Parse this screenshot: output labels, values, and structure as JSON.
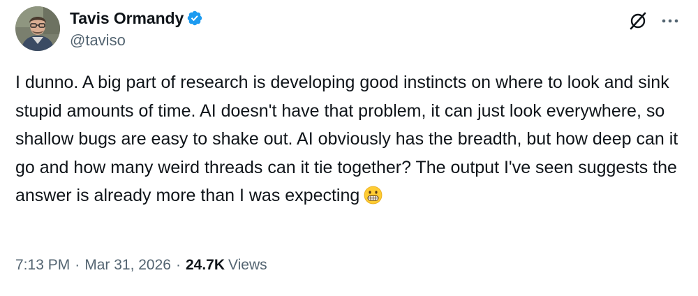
{
  "author": {
    "display_name": "Tavis Ormandy",
    "handle": "@taviso",
    "verified_badge_icon": "verified-checkmark-icon",
    "verified_color": "#1d9bf0"
  },
  "actions": {
    "grok_icon": "grok-icon",
    "more_icon": "more-horizontal-icon"
  },
  "tweet": {
    "text": "I dunno. A big part of research is developing good instincts on where to look and sink stupid amounts of time. AI doesn't have that problem, it can just look everywhere, so shallow bugs are easy to shake out. AI obviously has the breadth, but how deep can it go and how many weird threads can it tie together? The output I've seen suggests the answer is already more than I was expecting",
    "emoji": "grimacing-face-emoji"
  },
  "meta": {
    "time": "7:13 PM",
    "separator": "·",
    "date": "Mar 31, 2026",
    "views_count": "24.7K",
    "views_label": "Views"
  },
  "colors": {
    "text_primary": "#0f1419",
    "text_secondary": "#536471",
    "background": "#ffffff"
  }
}
